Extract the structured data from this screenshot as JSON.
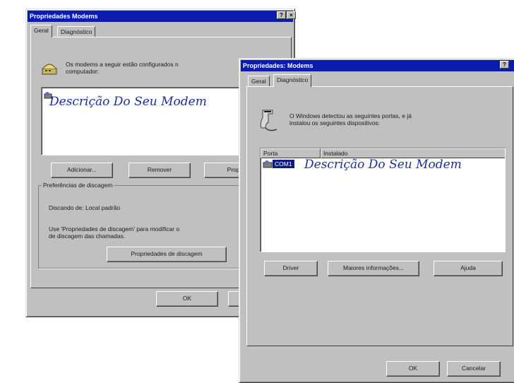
{
  "dialog1": {
    "title": "Propriedades Modems",
    "help_btn": "?",
    "close_btn": "×",
    "tabs": [
      "Geral",
      "Diagnóstico"
    ],
    "info_text_line1": "Os modems a seguir estão configurados n",
    "info_text_line2": "computador:",
    "modem_description": "Descrição Do Seu Modem",
    "buttons": {
      "add": "Adicionar...",
      "remove": "Remover",
      "properties": "Propri"
    },
    "dialing_group": {
      "label": "Preferências de discagem",
      "dialing_from": "Discando de:  Local padrão",
      "use_text_line1": "Use 'Propriedades de discagem' para modificar o",
      "use_text_line2": "de discagem das chamadas.",
      "dialing_props_button": "Propriedades de discagem"
    },
    "ok": "OK"
  },
  "dialog2": {
    "title": "Propriedades: Modems",
    "help_btn": "?",
    "tabs": [
      "Geral",
      "Diagnóstico"
    ],
    "info_text_line1": "O Windows detectou as seguintes portas, e já",
    "info_text_line2": "instalou os seguintes dispositivos:",
    "columns": [
      "Porta",
      "Instalado"
    ],
    "rows": [
      {
        "port": "COM1",
        "installed": "Descrição Do Seu Modem"
      }
    ],
    "buttons": {
      "driver": "Driver",
      "more_info": "Maiores informações...",
      "help": "Ajuda"
    },
    "ok": "OK",
    "cancel": "Cancelar"
  }
}
